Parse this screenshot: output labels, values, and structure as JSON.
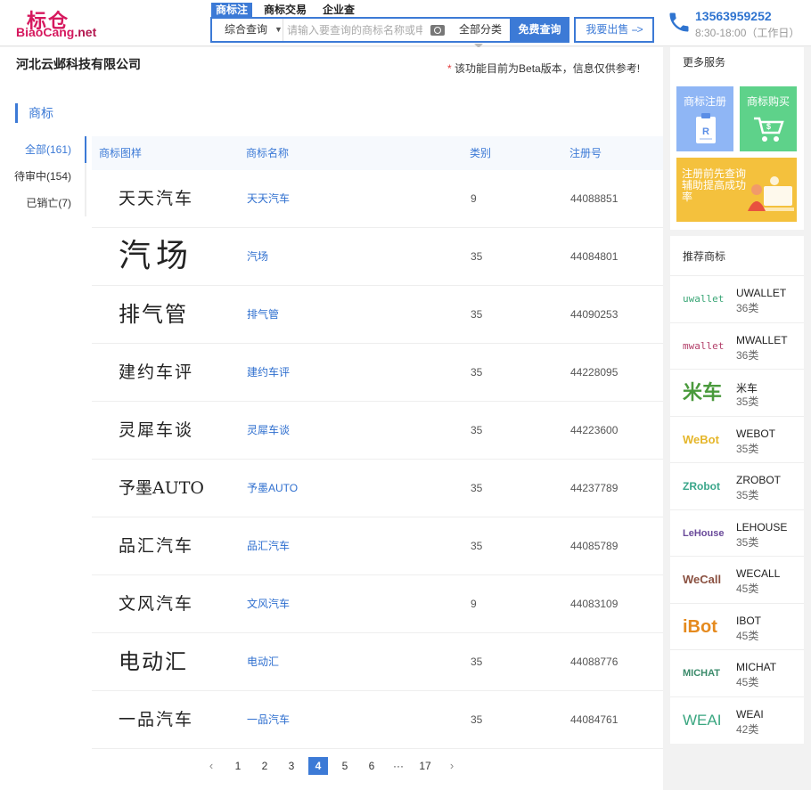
{
  "header": {
    "logo_cn": "标仓",
    "logo_en_main": "BiaoCang",
    "logo_en_suffix": ".net",
    "tabs": [
      "商标注",
      "商标交易",
      "企业查"
    ],
    "scope": "综合查询",
    "search_placeholder": "请输入要查询的商标名称或申请号",
    "category": "全部分类",
    "search_button": "免费查询",
    "sell_button": "我要出售",
    "sell_arrow": "-->",
    "phone": "13563959252",
    "hours": "8:30-18:00（工作日）"
  },
  "company": "河北云邺科技有限公司",
  "beta_star": "*",
  "beta_note": "该功能目前为Beta版本，信息仅供参考!",
  "section_title": "商标",
  "filters": [
    "全部(161)",
    "待审中(154)",
    "已销亡(7)"
  ],
  "table": {
    "headers": [
      "商标图样",
      "商标名称",
      "类别",
      "注册号"
    ],
    "rows": [
      {
        "image": "天天汽车",
        "name": "天天汽车",
        "class": "9",
        "reg": "44088851"
      },
      {
        "image": "汽场",
        "name": "汽场",
        "class": "35",
        "reg": "44084801"
      },
      {
        "image": "排气管",
        "name": "排气管",
        "class": "35",
        "reg": "44090253"
      },
      {
        "image": "建约车评",
        "name": "建约车评",
        "class": "35",
        "reg": "44228095"
      },
      {
        "image": "灵犀车谈",
        "name": "灵犀车谈",
        "class": "35",
        "reg": "44223600"
      },
      {
        "image": "予墨AUTO",
        "name": "予墨AUTO",
        "class": "35",
        "reg": "44237789"
      },
      {
        "image": "品汇汽车",
        "name": "品汇汽车",
        "class": "35",
        "reg": "44085789"
      },
      {
        "image": "文风汽车",
        "name": "文风汽车",
        "class": "9",
        "reg": "44083109"
      },
      {
        "image": "电动汇",
        "name": "电动汇",
        "class": "35",
        "reg": "44088776"
      },
      {
        "image": "一品汽车",
        "name": "一品汽车",
        "class": "35",
        "reg": "44084761"
      }
    ]
  },
  "pagination": {
    "prev": "‹",
    "pages": [
      "1",
      "2",
      "3",
      "4",
      "5",
      "6",
      "···",
      "17"
    ],
    "current": "4",
    "next": "›"
  },
  "sidebar": {
    "services_title": "更多服务",
    "service_register": "商标注册",
    "service_buy": "商标购买",
    "banner_text": "注册前先查询 辅助提高成功率",
    "recommend_title": "推荐商标",
    "recommend": [
      {
        "logo": "uwallet",
        "name": "UWALLET",
        "cls": "36类",
        "color": "#3aa676"
      },
      {
        "logo": "mwallet",
        "name": "MWALLET",
        "cls": "36类",
        "color": "#b3406a"
      },
      {
        "logo": "米车",
        "name": "米车",
        "cls": "35类",
        "color": "#4a9a3c"
      },
      {
        "logo": "WeBot",
        "name": "WEBOT",
        "cls": "35类",
        "color": "#e5b62a"
      },
      {
        "logo": "ZRobot",
        "name": "ZROBOT",
        "cls": "35类",
        "color": "#3aa68a"
      },
      {
        "logo": "LeHouse",
        "name": "LEHOUSE",
        "cls": "35类",
        "color": "#6a4a9a"
      },
      {
        "logo": "WeCall",
        "name": "WECALL",
        "cls": "45类",
        "color": "#8a5040"
      },
      {
        "logo": "iBot",
        "name": "IBOT",
        "cls": "45类",
        "color": "#e58a1e"
      },
      {
        "logo": "MICHAT",
        "name": "MICHAT",
        "cls": "45类",
        "color": "#3a8a6a"
      },
      {
        "logo": "WEAI",
        "name": "WEAI",
        "cls": "42类",
        "color": "#3aa680"
      }
    ]
  },
  "colors": {
    "accent": "#3c7ad6",
    "brand": "#d6185e"
  }
}
